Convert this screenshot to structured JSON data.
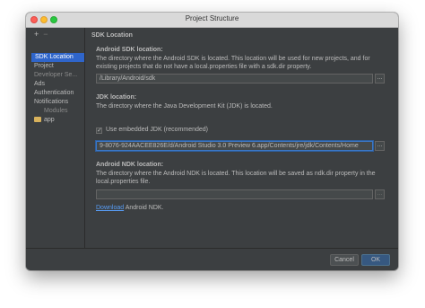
{
  "window": {
    "title": "Project Structure"
  },
  "sidebar": {
    "add_icon": "+",
    "remove_icon": "−",
    "items": [
      {
        "label": "SDK Location",
        "selected": true
      },
      {
        "label": "Project"
      },
      {
        "label": "Developer Se..."
      },
      {
        "label": "Ads"
      },
      {
        "label": "Authentication"
      },
      {
        "label": "Notifications"
      },
      {
        "label": "Modules"
      },
      {
        "label": "app"
      }
    ]
  },
  "main": {
    "heading": "SDK Location",
    "android_sdk": {
      "title": "Android SDK location:",
      "description": "The directory where the Android SDK is located. This location will be used for new projects, and for existing projects that do not have a local.properties file with a sdk.dir property.",
      "value": "/Library/Android/sdk",
      "browse": "..."
    },
    "jdk": {
      "title": "JDK location:",
      "description": "The directory where the Java Development Kit (JDK) is located.",
      "checkbox_label": "Use embedded JDK (recommended)",
      "checkbox_checked": true,
      "check_mark": "✓",
      "value": "9-8076-924AACEE826E/d/Android Studio 3.0 Preview 6.app/Contents/jre/jdk/Contents/Home",
      "browse": "..."
    },
    "ndk": {
      "title": "Android NDK location:",
      "description": "The directory where the Android NDK is located. This location will be saved as ndk.dir property in the local.properties file.",
      "value": "",
      "browse": "...",
      "download_link": "Download",
      "download_suffix": " Android NDK."
    }
  },
  "footer": {
    "cancel_label": "Cancel",
    "ok_label": "OK"
  },
  "colors": {
    "accent": "#2f65ca",
    "background": "#3c3f41",
    "link": "#589df6"
  }
}
